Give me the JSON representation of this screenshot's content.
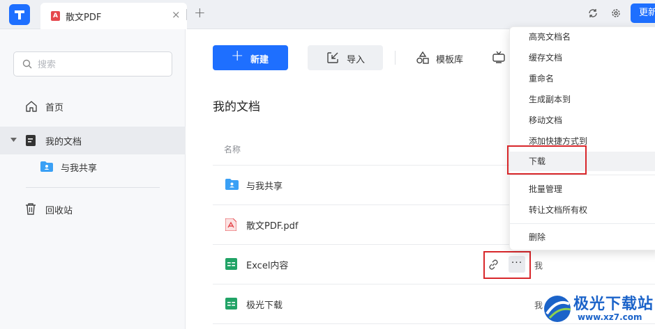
{
  "tabs": {
    "active_title": "散文PDF",
    "close_symbol": "×",
    "add_symbol": "+",
    "update_label": "更新"
  },
  "sidebar": {
    "search_placeholder": "搜索",
    "items": [
      {
        "label": "首页",
        "icon": "home-icon"
      },
      {
        "label": "我的文档",
        "icon": "document-icon",
        "expanded": true
      },
      {
        "label": "与我共享",
        "icon": "shared-folder-icon"
      },
      {
        "label": "回收站",
        "icon": "trash-icon"
      }
    ]
  },
  "toolbar": {
    "new_label": "新建",
    "import_label": "导入",
    "template_label": "模板库"
  },
  "main": {
    "title": "我的文档",
    "column_name": "名称",
    "files": [
      {
        "name": "与我共享",
        "type": "folder",
        "owner": ""
      },
      {
        "name": "散文PDF.pdf",
        "type": "pdf",
        "owner": ""
      },
      {
        "name": "Excel内容",
        "type": "sheet",
        "owner": "我"
      },
      {
        "name": "极光下载",
        "type": "sheet",
        "owner": "我"
      }
    ],
    "more_symbol": "···"
  },
  "context_menu": {
    "items": [
      "高亮文档名",
      "缓存文档",
      "重命名",
      "生成副本到",
      "移动文档",
      "添加快捷方式到",
      "下载",
      "批量管理",
      "转让文档所有权",
      "删除"
    ],
    "highlighted": "下载"
  },
  "watermark": {
    "brand": "极光下载站",
    "url": "www.xz7.com"
  },
  "colors": {
    "accent": "#1e6fff",
    "annotation_red": "#d8262a",
    "sheet_green": "#21a366",
    "pdf_red": "#e5484d",
    "folder_blue": "#3aa0f5"
  }
}
